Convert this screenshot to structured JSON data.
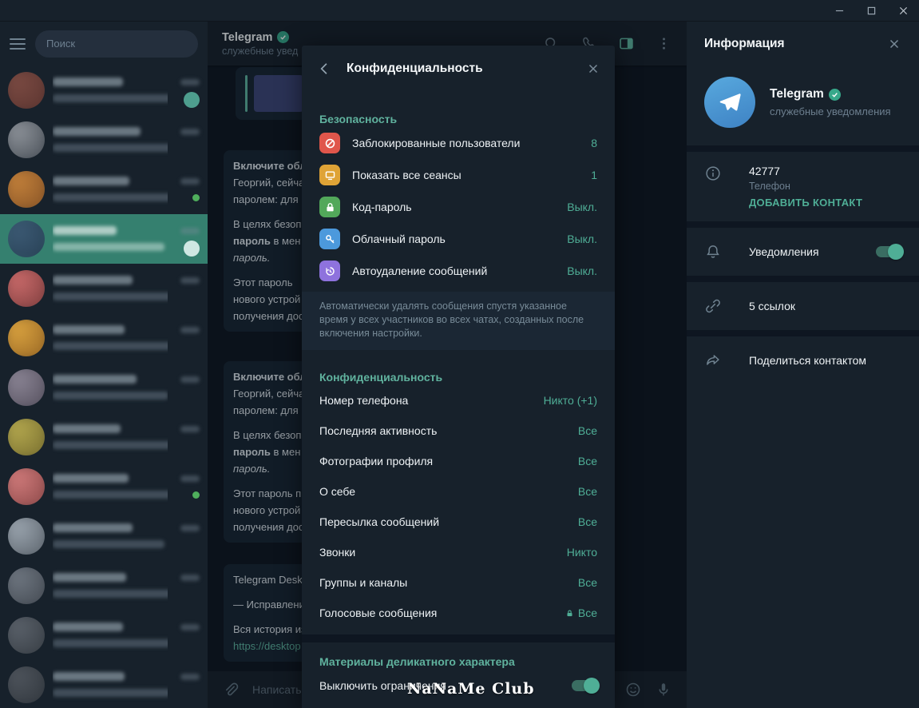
{
  "watermark": "NaNaMe Club",
  "titlebar": {
    "minimize": "minimize",
    "maximize": "maximize",
    "close": "close"
  },
  "sidebar": {
    "search_placeholder": "Поиск",
    "chats": [
      {
        "c1": "#7a4a42",
        "c2": "#55302c",
        "name_w": 88,
        "msg_w": 150,
        "badge": "teal"
      },
      {
        "c1": "#8d9299",
        "c2": "#3a4149",
        "name_w": 110,
        "msg_w": 170
      },
      {
        "c1": "#c2803a",
        "c2": "#7a4a22",
        "name_w": 96,
        "msg_w": 160,
        "dot": true
      },
      {
        "c1": "#3c5a74",
        "c2": "#233a4e",
        "name_w": 80,
        "msg_w": 140,
        "selected": true,
        "badge": "light"
      },
      {
        "c1": "#c96a6a",
        "c2": "#6e3434",
        "name_w": 100,
        "msg_w": 155
      },
      {
        "c1": "#d9a23f",
        "c2": "#8a5a1e",
        "name_w": 90,
        "msg_w": 165
      },
      {
        "c1": "#8a8494",
        "c2": "#4a4552",
        "name_w": 105,
        "msg_w": 145
      },
      {
        "c1": "#b3a74e",
        "c2": "#6b6228",
        "name_w": 85,
        "msg_w": 158
      },
      {
        "c1": "#cf7a7a",
        "c2": "#7e3e3e",
        "name_w": 95,
        "msg_w": 150,
        "dot": true
      },
      {
        "c1": "#9aa4ae",
        "c2": "#4e565e",
        "name_w": 100,
        "msg_w": 140
      },
      {
        "c1": "#6e7680",
        "c2": "#3a4048",
        "name_w": 92,
        "msg_w": 160
      },
      {
        "c1": "#5a616a",
        "c2": "#30363c",
        "name_w": 88,
        "msg_w": 150
      },
      {
        "c1": "#4e545c",
        "c2": "#2a3036",
        "name_w": 90,
        "msg_w": 148
      }
    ]
  },
  "chat_header": {
    "title": "Telegram",
    "subtitle": "служебные увед"
  },
  "messages": {
    "bubble2": {
      "lines": [
        [
          {
            "t": "Включите обл",
            "s": "b"
          }
        ],
        [
          {
            "t": "Георгий, сейча"
          }
        ],
        [
          {
            "t": "паролем: для в"
          }
        ],
        [],
        [
          {
            "t": "В целях безопа"
          }
        ],
        [
          {
            "t": "пароль",
            "s": "b"
          },
          {
            "t": " в мен"
          }
        ],
        [
          {
            "t": "пароль.",
            "s": "i"
          }
        ],
        [],
        [
          {
            "t": "Этот пароль"
          }
        ],
        [
          {
            "t": "нового устрой"
          }
        ],
        [
          {
            "t": "получения дос"
          }
        ]
      ]
    },
    "bubble3": {
      "lines": [
        [
          {
            "t": "Включите обл",
            "s": "b"
          }
        ],
        [
          {
            "t": "Георгий, сейча"
          }
        ],
        [
          {
            "t": "паролем: для в"
          }
        ],
        [],
        [
          {
            "t": "В целях безопа"
          }
        ],
        [
          {
            "t": "пароль",
            "s": "b"
          },
          {
            "t": " в мен"
          }
        ],
        [
          {
            "t": "пароль.",
            "s": "i"
          }
        ],
        [],
        [
          {
            "t": "Этот пароль п"
          }
        ],
        [
          {
            "t": "нового устрой"
          }
        ],
        [
          {
            "t": "получения дос"
          }
        ]
      ]
    },
    "bubble4": {
      "lines": [
        [
          {
            "t": "Telegram Deskt"
          }
        ],
        [],
        [
          {
            "t": "— Исправлени"
          }
        ],
        [],
        [
          {
            "t": "Вся история из"
          }
        ],
        [
          {
            "t": "https://desktop",
            "s": "link"
          }
        ]
      ]
    }
  },
  "composer": {
    "placeholder": "Написать с"
  },
  "modal": {
    "title": "Конфиденциальность",
    "security": {
      "heading": "Безопасность",
      "rows": [
        {
          "icon": "blocked-users-icon",
          "color": "#e0564b",
          "label": "Заблокированные пользователи",
          "value": "8"
        },
        {
          "icon": "sessions-icon",
          "color": "#dfa336",
          "label": "Показать все сеансы",
          "value": "1"
        },
        {
          "icon": "passcode-lock-icon",
          "color": "#52a85a",
          "label": "Код-пароль",
          "value": "Выкл."
        },
        {
          "icon": "cloud-password-key-icon",
          "color": "#4c99dc",
          "label": "Облачный пароль",
          "value": "Выкл."
        },
        {
          "icon": "auto-delete-timer-icon",
          "color": "#8e72dd",
          "label": "Автоудаление сообщений",
          "value": "Выкл."
        }
      ],
      "note": "Автоматически удалять сообщения спустя указанное время у всех участников во всех чатах, созданных после включения настройки."
    },
    "privacy": {
      "heading": "Конфиденциальность",
      "rows": [
        {
          "label": "Номер телефона",
          "value": "Никто (+1)"
        },
        {
          "label": "Последняя активность",
          "value": "Все"
        },
        {
          "label": "Фотографии профиля",
          "value": "Все"
        },
        {
          "label": "О себе",
          "value": "Все"
        },
        {
          "label": "Пересылка сообщений",
          "value": "Все"
        },
        {
          "label": "Звонки",
          "value": "Никто"
        },
        {
          "label": "Группы и каналы",
          "value": "Все"
        },
        {
          "label": "Голосовые сообщения",
          "value": "Все",
          "locked": true
        }
      ]
    },
    "sensitive": {
      "heading": "Материалы деликатного характера",
      "row_label": "Выключить ограничения",
      "toggle_on": true
    }
  },
  "info_panel": {
    "title": "Информация",
    "name": "Telegram",
    "subtitle": "служебные уведомления",
    "phone_value": "42777",
    "phone_label": "Телефон",
    "add_contact": "ДОБАВИТЬ КОНТАКТ",
    "notifications_label": "Уведомления",
    "notifications_on": true,
    "links_label": "5 ссылок",
    "share_label": "Поделиться контактом"
  },
  "colors": {
    "accent": "#5eb5a0",
    "value_teal": "#4fae96",
    "selected_chat": "#35806f"
  }
}
